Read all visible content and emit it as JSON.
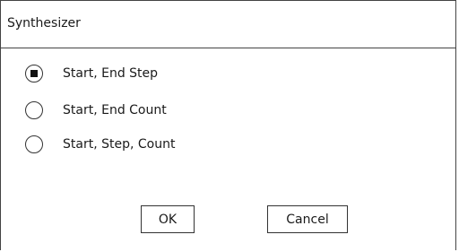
{
  "dialog": {
    "title": "Synthesizer",
    "options": [
      {
        "label": "Start, End Step",
        "selected": true
      },
      {
        "label": "Start, End Count",
        "selected": false
      },
      {
        "label": "Start, Step, Count",
        "selected": false
      }
    ],
    "buttons": {
      "ok_label": "OK",
      "cancel_label": "Cancel"
    }
  }
}
